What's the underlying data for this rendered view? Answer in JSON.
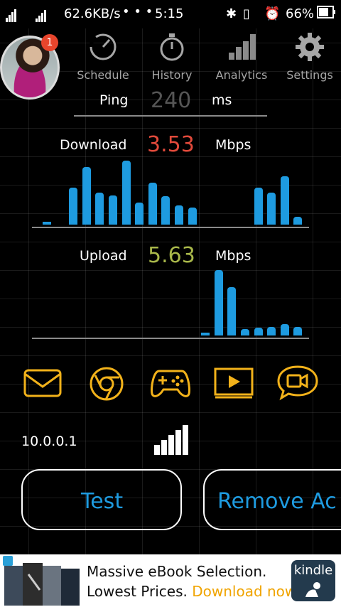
{
  "status_bar": {
    "network_speed": "62.6KB/s",
    "more": "• • •",
    "time": "5:15",
    "battery": "66%",
    "icons": [
      "signal-icon",
      "data-icon",
      "bluetooth-icon",
      "vibrate-icon",
      "alarm-icon",
      "battery-icon"
    ]
  },
  "nav": {
    "badge": "1",
    "items": [
      {
        "label": "Schedule",
        "icon": "schedule-icon"
      },
      {
        "label": "History",
        "icon": "stopwatch-icon"
      },
      {
        "label": "Analytics",
        "icon": "analytics-icon"
      },
      {
        "label": "Settings",
        "icon": "gear-icon"
      }
    ]
  },
  "ping": {
    "label": "Ping",
    "value": "240",
    "unit": "ms",
    "color": "#555555"
  },
  "download": {
    "label": "Download",
    "value": "3.53",
    "unit": "Mbps",
    "color": "#e24a3b",
    "bars": [
      0.04,
      0.0,
      0.58,
      0.9,
      0.5,
      0.46,
      1.0,
      0.34,
      0.66,
      0.44,
      0.3,
      0.27,
      0.0,
      0.0,
      0.0,
      0.0,
      0.58,
      0.5,
      0.76,
      0.12
    ]
  },
  "upload": {
    "label": "Upload",
    "value": "5.63",
    "unit": "Mbps",
    "color": "#a9b84a",
    "bars": [
      0.0,
      0.0,
      0.0,
      0.0,
      0.0,
      0.0,
      0.0,
      0.0,
      0.0,
      0.0,
      0.0,
      0.0,
      0.02,
      1.0,
      0.74,
      0.1,
      0.12,
      0.13,
      0.17,
      0.13
    ]
  },
  "app_icons": [
    "email-icon",
    "browser-icon",
    "gamepad-icon",
    "video-icon",
    "video-chat-icon"
  ],
  "ip": "10.0.0.1",
  "wifi_level": 5,
  "buttons": {
    "test": "Test",
    "remove": "Remove Ac"
  },
  "ad": {
    "line1": "Massive eBook Selection.",
    "line2_a": "Lowest Prices. ",
    "line2_b": "Download now",
    "brand": "kindle"
  }
}
